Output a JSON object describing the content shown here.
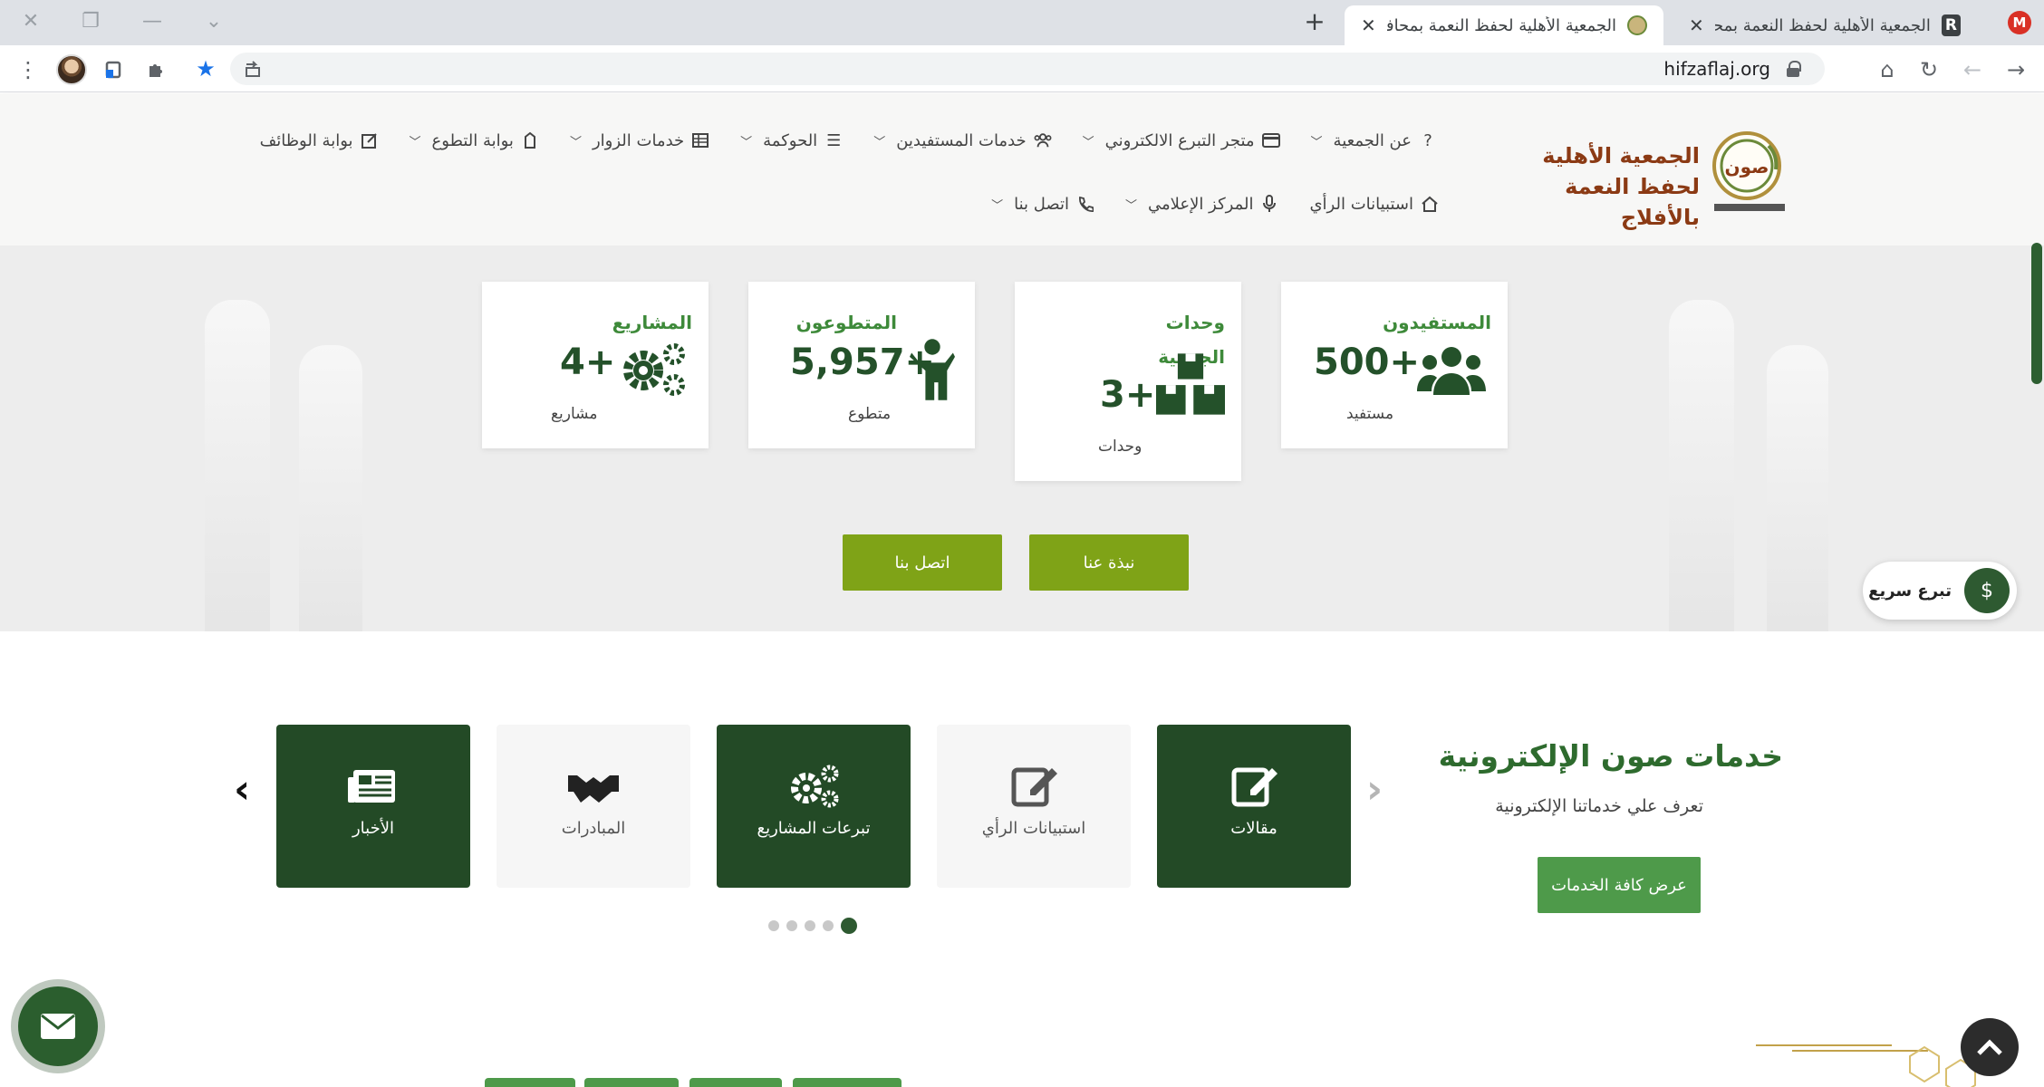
{
  "browser": {
    "tabs": [
      {
        "title": "الجمعية الأهلية لحفظ النعمة بمحافظ",
        "active": false
      },
      {
        "title": "الجمعية الأهلية لحفظ النعمة بمحافظ",
        "active": true
      }
    ],
    "url": "hifzaflaj.org",
    "favicon_r": "R",
    "favicon_m": "M"
  },
  "header": {
    "logo_text_line1": "الجمعية الأهلية",
    "logo_text_line2": "لحفظ النعمة بالأفلاج",
    "nav_row1": [
      {
        "label": "عن الجمعية",
        "icon": "question-icon"
      },
      {
        "label": "متجر التبرع الالكتروني",
        "icon": "card-icon"
      },
      {
        "label": "خدمات المستفيدين",
        "icon": "users-icon"
      },
      {
        "label": "الحوكمة",
        "icon": "list-icon"
      },
      {
        "label": "خدمات الزوار",
        "icon": "table-icon"
      },
      {
        "label": "بوابة التطوع",
        "icon": "shirt-icon"
      },
      {
        "label": "بوابة الوظائف",
        "icon": "edit-icon"
      }
    ],
    "nav_row2": [
      {
        "label": "استبيانات الرأي",
        "icon": "home-icon"
      },
      {
        "label": "المركز الإعلامي",
        "icon": "mic-icon"
      },
      {
        "label": "اتصل بنا",
        "icon": "phone-icon"
      }
    ]
  },
  "stats": [
    {
      "title": "المستفيدون",
      "value": "500+",
      "unit": "مستفيد",
      "icon": "users-icon"
    },
    {
      "title": "وحدات الجمعية",
      "value": "3+",
      "unit": "وحدات",
      "icon": "boxes-icon"
    },
    {
      "title": "المتطوعون",
      "value": "5,957+",
      "unit": "متطوع",
      "icon": "person-icon"
    },
    {
      "title": "المشاريع",
      "value": "4+",
      "unit": "مشاريع",
      "icon": "gears-icon"
    }
  ],
  "hero_buttons": {
    "about": "نبذة عنا",
    "contact": "اتصل بنا"
  },
  "quick_donate": "تبرع سريع",
  "services": {
    "title": "خدمات صون الإلكترونية",
    "subtitle": "تعرف علي خدماتنا الإلكترونية",
    "view_all": "عرض كافة الخدمات",
    "cards": [
      {
        "label": "مقالات",
        "icon": "edit-icon",
        "style": "dark"
      },
      {
        "label": "استبيانات الرأي",
        "icon": "edit-icon",
        "style": "light"
      },
      {
        "label": "تبرعات المشاريع",
        "icon": "gears-icon",
        "style": "dark"
      },
      {
        "label": "المبادرات",
        "icon": "handshake-icon",
        "style": "light"
      },
      {
        "label": "الأخبار",
        "icon": "newspaper-icon",
        "style": "dark"
      }
    ],
    "carousel_pages": 5,
    "carousel_active_page": 5
  },
  "colors": {
    "brand_green": "#234a26",
    "accent_green": "#4e9a4a",
    "lime": "#7fa317",
    "logo_brown": "#8b3a14"
  }
}
